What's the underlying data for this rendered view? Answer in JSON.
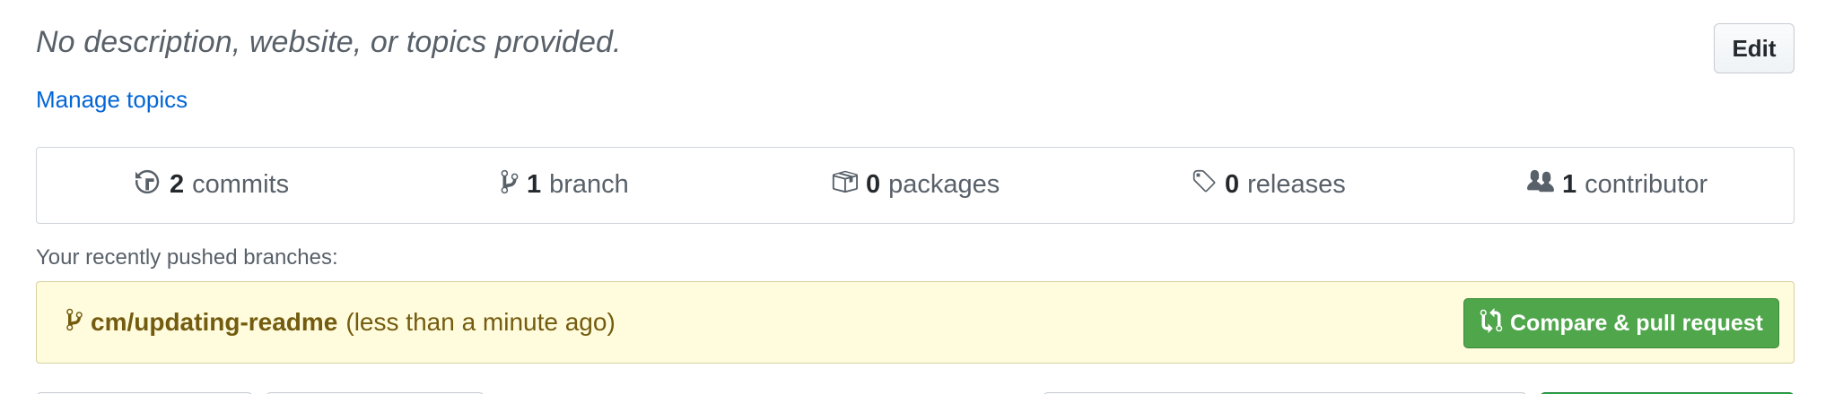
{
  "repo": {
    "description": "No description, website, or topics provided.",
    "edit_label": "Edit",
    "manage_topics_label": "Manage topics"
  },
  "stats": {
    "commits": {
      "count": "2",
      "label": "commits",
      "icon": "history-icon"
    },
    "branch": {
      "count": "1",
      "label": "branch",
      "icon": "git-branch-icon"
    },
    "packages": {
      "count": "0",
      "label": "packages",
      "icon": "package-icon"
    },
    "releases": {
      "count": "0",
      "label": "releases",
      "icon": "tag-icon"
    },
    "contributors": {
      "count": "1",
      "label": "contributor",
      "icon": "people-icon"
    }
  },
  "recent_push": {
    "heading": "Your recently pushed branches:",
    "branch_name": "cm/updating-readme",
    "time_ago": "(less than a minute ago)",
    "compare_label": "Compare & pull request",
    "icon": "git-branch-icon",
    "compare_icon": "git-compare-icon"
  },
  "colors": {
    "link": "#0366d6",
    "banner_bg": "#fffbdd",
    "banner_text": "#735c0f",
    "primary_button": "#4fa64b"
  }
}
